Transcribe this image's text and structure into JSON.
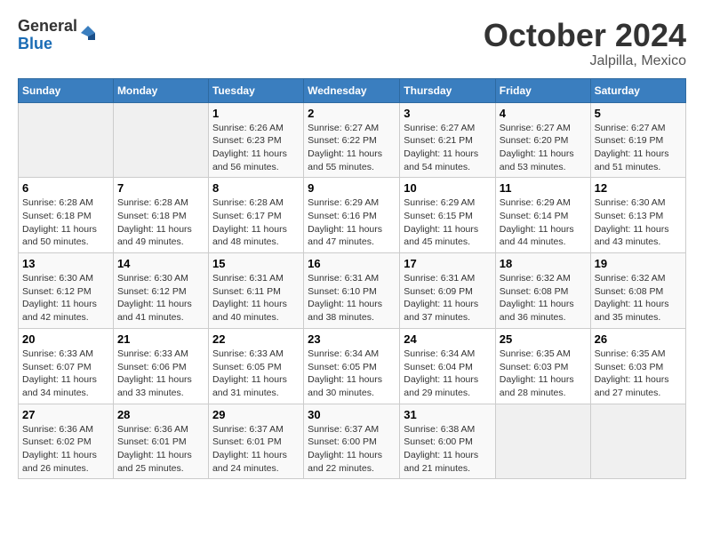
{
  "logo": {
    "general": "General",
    "blue": "Blue"
  },
  "title": "October 2024",
  "subtitle": "Jalpilla, Mexico",
  "days_of_week": [
    "Sunday",
    "Monday",
    "Tuesday",
    "Wednesday",
    "Thursday",
    "Friday",
    "Saturday"
  ],
  "weeks": [
    [
      {
        "day": "",
        "info": ""
      },
      {
        "day": "",
        "info": ""
      },
      {
        "day": "1",
        "info": "Sunrise: 6:26 AM\nSunset: 6:23 PM\nDaylight: 11 hours and 56 minutes."
      },
      {
        "day": "2",
        "info": "Sunrise: 6:27 AM\nSunset: 6:22 PM\nDaylight: 11 hours and 55 minutes."
      },
      {
        "day": "3",
        "info": "Sunrise: 6:27 AM\nSunset: 6:21 PM\nDaylight: 11 hours and 54 minutes."
      },
      {
        "day": "4",
        "info": "Sunrise: 6:27 AM\nSunset: 6:20 PM\nDaylight: 11 hours and 53 minutes."
      },
      {
        "day": "5",
        "info": "Sunrise: 6:27 AM\nSunset: 6:19 PM\nDaylight: 11 hours and 51 minutes."
      }
    ],
    [
      {
        "day": "6",
        "info": "Sunrise: 6:28 AM\nSunset: 6:18 PM\nDaylight: 11 hours and 50 minutes."
      },
      {
        "day": "7",
        "info": "Sunrise: 6:28 AM\nSunset: 6:18 PM\nDaylight: 11 hours and 49 minutes."
      },
      {
        "day": "8",
        "info": "Sunrise: 6:28 AM\nSunset: 6:17 PM\nDaylight: 11 hours and 48 minutes."
      },
      {
        "day": "9",
        "info": "Sunrise: 6:29 AM\nSunset: 6:16 PM\nDaylight: 11 hours and 47 minutes."
      },
      {
        "day": "10",
        "info": "Sunrise: 6:29 AM\nSunset: 6:15 PM\nDaylight: 11 hours and 45 minutes."
      },
      {
        "day": "11",
        "info": "Sunrise: 6:29 AM\nSunset: 6:14 PM\nDaylight: 11 hours and 44 minutes."
      },
      {
        "day": "12",
        "info": "Sunrise: 6:30 AM\nSunset: 6:13 PM\nDaylight: 11 hours and 43 minutes."
      }
    ],
    [
      {
        "day": "13",
        "info": "Sunrise: 6:30 AM\nSunset: 6:12 PM\nDaylight: 11 hours and 42 minutes."
      },
      {
        "day": "14",
        "info": "Sunrise: 6:30 AM\nSunset: 6:12 PM\nDaylight: 11 hours and 41 minutes."
      },
      {
        "day": "15",
        "info": "Sunrise: 6:31 AM\nSunset: 6:11 PM\nDaylight: 11 hours and 40 minutes."
      },
      {
        "day": "16",
        "info": "Sunrise: 6:31 AM\nSunset: 6:10 PM\nDaylight: 11 hours and 38 minutes."
      },
      {
        "day": "17",
        "info": "Sunrise: 6:31 AM\nSunset: 6:09 PM\nDaylight: 11 hours and 37 minutes."
      },
      {
        "day": "18",
        "info": "Sunrise: 6:32 AM\nSunset: 6:08 PM\nDaylight: 11 hours and 36 minutes."
      },
      {
        "day": "19",
        "info": "Sunrise: 6:32 AM\nSunset: 6:08 PM\nDaylight: 11 hours and 35 minutes."
      }
    ],
    [
      {
        "day": "20",
        "info": "Sunrise: 6:33 AM\nSunset: 6:07 PM\nDaylight: 11 hours and 34 minutes."
      },
      {
        "day": "21",
        "info": "Sunrise: 6:33 AM\nSunset: 6:06 PM\nDaylight: 11 hours and 33 minutes."
      },
      {
        "day": "22",
        "info": "Sunrise: 6:33 AM\nSunset: 6:05 PM\nDaylight: 11 hours and 31 minutes."
      },
      {
        "day": "23",
        "info": "Sunrise: 6:34 AM\nSunset: 6:05 PM\nDaylight: 11 hours and 30 minutes."
      },
      {
        "day": "24",
        "info": "Sunrise: 6:34 AM\nSunset: 6:04 PM\nDaylight: 11 hours and 29 minutes."
      },
      {
        "day": "25",
        "info": "Sunrise: 6:35 AM\nSunset: 6:03 PM\nDaylight: 11 hours and 28 minutes."
      },
      {
        "day": "26",
        "info": "Sunrise: 6:35 AM\nSunset: 6:03 PM\nDaylight: 11 hours and 27 minutes."
      }
    ],
    [
      {
        "day": "27",
        "info": "Sunrise: 6:36 AM\nSunset: 6:02 PM\nDaylight: 11 hours and 26 minutes."
      },
      {
        "day": "28",
        "info": "Sunrise: 6:36 AM\nSunset: 6:01 PM\nDaylight: 11 hours and 25 minutes."
      },
      {
        "day": "29",
        "info": "Sunrise: 6:37 AM\nSunset: 6:01 PM\nDaylight: 11 hours and 24 minutes."
      },
      {
        "day": "30",
        "info": "Sunrise: 6:37 AM\nSunset: 6:00 PM\nDaylight: 11 hours and 22 minutes."
      },
      {
        "day": "31",
        "info": "Sunrise: 6:38 AM\nSunset: 6:00 PM\nDaylight: 11 hours and 21 minutes."
      },
      {
        "day": "",
        "info": ""
      },
      {
        "day": "",
        "info": ""
      }
    ]
  ]
}
